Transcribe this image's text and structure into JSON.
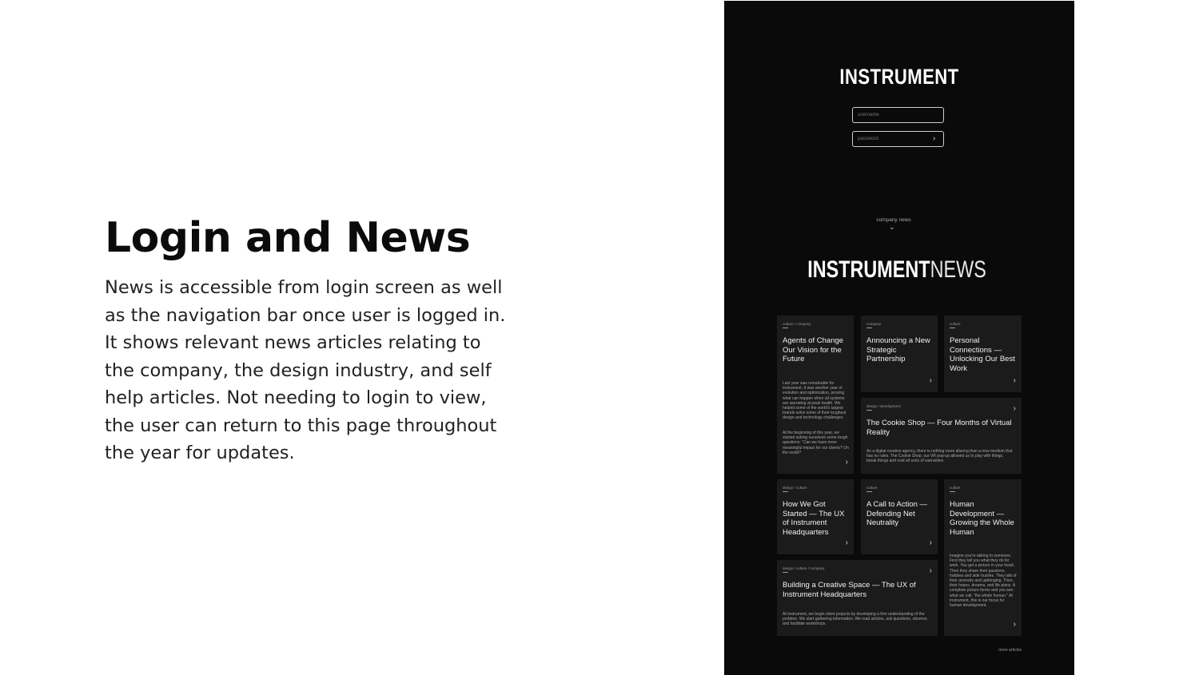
{
  "slide": {
    "heading": "Login and News",
    "description": "News is accessible from login screen as well as the navigation bar once user is logged in. It shows relevant news articles relating to the company, the design industry, and self help articles. Not needing to login to view, the user can return to this page throughout the year for updates."
  },
  "app": {
    "logo": "INSTRUMENT",
    "login": {
      "username_placeholder": "username",
      "password_placeholder": "password",
      "submit_icon": "chevron-right-icon"
    },
    "company_news_link": "company news",
    "scroll_icon": "chevron-down-icon",
    "news_title_bold": "INSTRUMENT",
    "news_title_light": "NEWS",
    "more_articles": "more articles",
    "articles": [
      {
        "tag": "culture / company",
        "title": "Agents of Change Our Vision for the Future",
        "text1": "Last year was remarkable for Instrument. It was another year of evolution and optimization, proving what can happen when all systems are operating at peak health. We helped some of the world's largest brands solve some of their toughest design and technology challenges.",
        "text2": "At the beginning of this year, we started asking ourselves some tough questions: \"Can we have more meaningful impact for our clients? On the world?"
      },
      {
        "tag": "company",
        "title": "Announcing a New Strategic Partnership"
      },
      {
        "tag": "culture",
        "title": "Personal Connections — Unlocking Our Best Work"
      },
      {
        "tag": "design / development",
        "title": "The Cookie Shop — Four Months of Virtual Reality",
        "text1": "As a digital creative agency, there is nothing more alluring than a new medium that has no rules. The Cookie Shop, our VR pop-up allowed us to play with things, break things and void all sorts of warranties."
      },
      {
        "tag": "design / culture",
        "title": "How We Got Started — The UX of Instrument Headquarters"
      },
      {
        "tag": "culture",
        "title": "A Call to Action — Defending Net Neutrality"
      },
      {
        "tag": "culture",
        "title": "Human Development — Growing the Whole Human",
        "text1": "Imagine you're talking to someone. First they tell you what they do for work. You get a picture in your head. Then they share their passions, hobbies and side hustles. They talk of their ancestry and upbringing. Then, their hopes, dreams, and life plans. A complete picture forms and you see: what we call, \"the whole human.\" At Instrument, this is our focus for human development."
      },
      {
        "tag": "design / culture / company",
        "title": "Building a Creative Space — The UX of Instrument Headquarters",
        "text1": "At Instrument, we begin client projects by developing a firm understanding of the problem. We start gathering information. We read articles, ask questions, observe, and facilitate workshops."
      }
    ]
  },
  "colors": {
    "app_bg": "#0a0a0a",
    "card_bg": "#1b1b1b",
    "page_bg": "#ffffff"
  }
}
